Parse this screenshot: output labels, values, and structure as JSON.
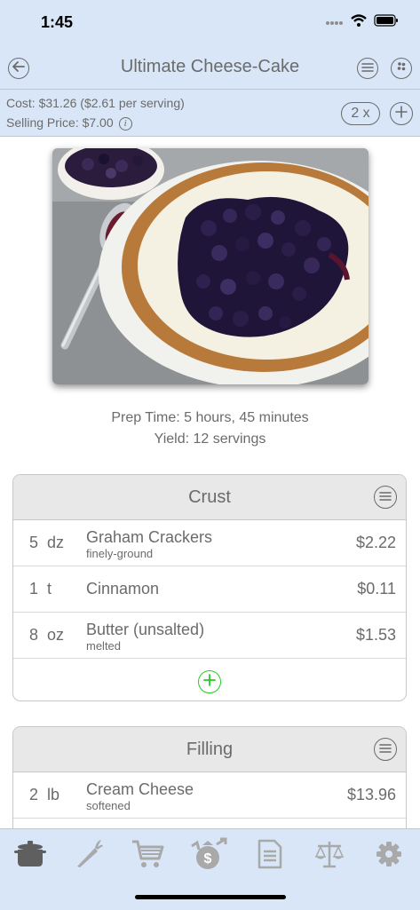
{
  "status": {
    "time": "1:45"
  },
  "nav": {
    "title": "Ultimate Cheese-Cake"
  },
  "cost": {
    "cost_text": "Cost: $31.26 ($2.61 per serving)",
    "selling_text": "Selling Price: $7.00",
    "multiplier": "2 x"
  },
  "info": {
    "prep_time": "Prep Time: 5 hours, 45 minutes",
    "yield": "Yield: 12 servings"
  },
  "sections": [
    {
      "title": "Crust",
      "items": [
        {
          "qty": "5",
          "unit": "dz",
          "name": "Graham Crackers",
          "note": "finely-ground",
          "price": "$2.22"
        },
        {
          "qty": "1",
          "unit": "t",
          "name": "Cinnamon",
          "note": "",
          "price": "$0.11"
        },
        {
          "qty": "8",
          "unit": "oz",
          "name": "Butter (unsalted)",
          "note": "melted",
          "price": "$1.53"
        }
      ]
    },
    {
      "title": "Filling",
      "items": [
        {
          "qty": "2",
          "unit": "lb",
          "name": "Cream Cheese",
          "note": "softened",
          "price": "$13.96"
        }
      ]
    }
  ],
  "tabs": [
    {
      "icon": "pot-icon",
      "active": true
    },
    {
      "icon": "carrot-icon",
      "active": false
    },
    {
      "icon": "cart-icon",
      "active": false
    },
    {
      "icon": "money-bag-icon",
      "active": false
    },
    {
      "icon": "document-icon",
      "active": false
    },
    {
      "icon": "scales-icon",
      "active": false
    },
    {
      "icon": "gear-icon",
      "active": false
    }
  ],
  "colors": {
    "bar_background": "#d8e6f8",
    "text": "#6b6b6b",
    "add_green": "#22cc22",
    "tab_inactive": "#a9a9a9",
    "tab_active": "#5f5f5f"
  }
}
